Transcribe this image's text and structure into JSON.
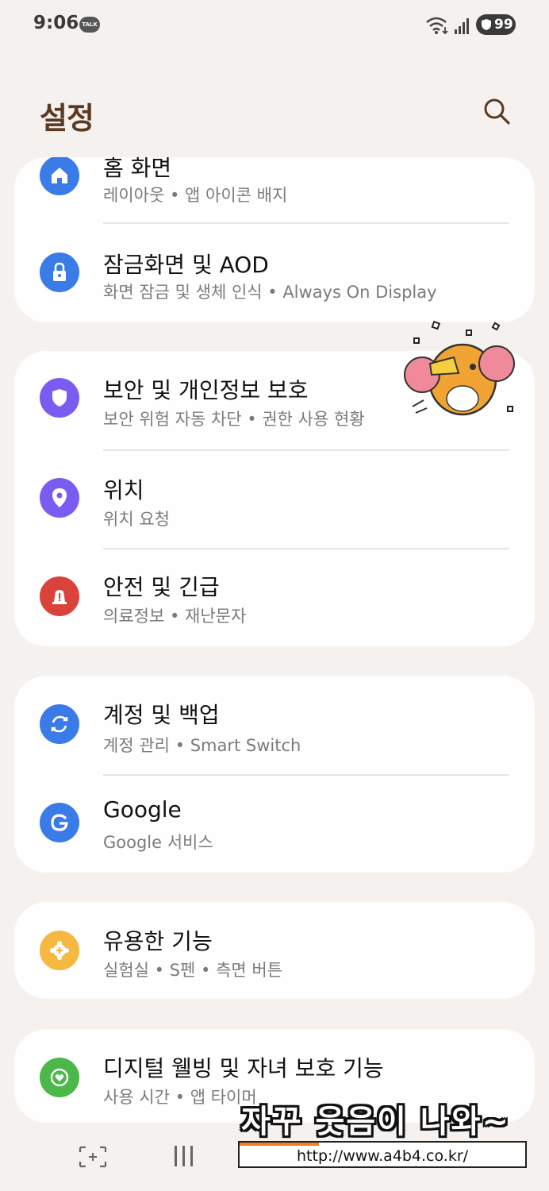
{
  "status_bar": {
    "time": "9:06",
    "talk_badge": "TALK",
    "battery": "99"
  },
  "header": {
    "title": "설정",
    "search_icon": "search-icon"
  },
  "groups": [
    {
      "items": [
        {
          "title": "홈 화면",
          "subtitle": "레이아웃  •  앱 아이콘 배지",
          "icon": "home-icon",
          "color": "#3a7be8"
        },
        {
          "title": "잠금화면 및 AOD",
          "subtitle": "화면 잠금 및 생체 인식  •  Always On Display",
          "icon": "lock-icon",
          "color": "#3a7be8"
        }
      ]
    },
    {
      "items": [
        {
          "title": "보안 및 개인정보 보호",
          "subtitle": "보안 위험 자동 차단  •  권한 사용 현황",
          "icon": "shield-icon",
          "color": "#7a5cf0"
        },
        {
          "title": "위치",
          "subtitle": "위치 요청",
          "icon": "location-pin-icon",
          "color": "#7a5cf0"
        },
        {
          "title": "안전 및 긴급",
          "subtitle": "의료정보  •  재난문자",
          "icon": "emergency-light-icon",
          "color": "#d9433b"
        }
      ]
    },
    {
      "items": [
        {
          "title": "계정 및 백업",
          "subtitle": "계정 관리  •  Smart Switch",
          "icon": "sync-icon",
          "color": "#3a7be8"
        },
        {
          "title": "Google",
          "subtitle": "Google 서비스",
          "icon": "google-icon",
          "color": "#3a7be8"
        }
      ]
    },
    {
      "items": [
        {
          "title": "유용한 기능",
          "subtitle": "실험실  •  S펜  •  측면 버튼",
          "icon": "plus-gear-icon",
          "color": "#f5b842"
        }
      ]
    },
    {
      "items": [
        {
          "title": "디지털 웰빙 및 자녀 보호 기능",
          "subtitle": "사용 시간  •  앱 타이머",
          "icon": "wellbeing-heart-icon",
          "color": "#4cb84a"
        }
      ]
    }
  ],
  "watermark": {
    "text": "자꾸 웃음이 나와~",
    "url": "http://www.a4b4.co.kr/"
  },
  "nav_bar": {
    "recent_icon": "recent-apps-icon",
    "home_icon": "home-button-icon",
    "back_icon": "back-icon"
  }
}
